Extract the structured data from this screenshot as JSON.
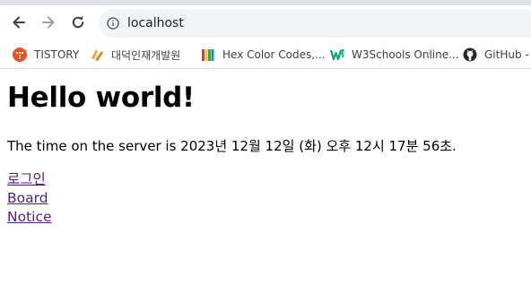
{
  "browser": {
    "address_bar": {
      "url": "localhost"
    },
    "bookmarks": [
      {
        "label": "TISTORY",
        "icon": "tistory-icon"
      },
      {
        "label": "대덕인재개발원",
        "icon": "bookmark-favicon-icon"
      },
      {
        "label": "Hex Color Codes,...",
        "icon": "color-book-icon"
      },
      {
        "label": "W3Schools Online...",
        "icon": "w3schools-icon"
      },
      {
        "label": "GitHub -",
        "icon": "github-icon"
      }
    ]
  },
  "page": {
    "heading": "Hello world!",
    "server_time_text": "The time on the server is 2023년 12월 12일 (화) 오후 12시 17분 56초.",
    "links": [
      {
        "label": "로그인"
      },
      {
        "label": "Board"
      },
      {
        "label": "Notice"
      }
    ]
  },
  "colors": {
    "link_visited": "#551a8b",
    "omnibox_bg": "#f1f3f4",
    "tistory_red": "#eb531f",
    "w3_green": "#04aa6d"
  }
}
